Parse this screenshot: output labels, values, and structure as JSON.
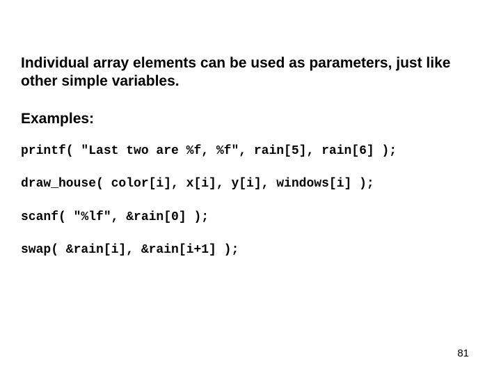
{
  "intro": "Individual array elements can be used as parameters, just like other simple variables.",
  "examples_label": "Examples:",
  "code": {
    "line1": "printf( \"Last two are %f, %f\", rain[5], rain[6] );",
    "line2": "draw_house( color[i], x[i], y[i], windows[i] );",
    "line3": "scanf( \"%lf\", &rain[0] );",
    "line4": "swap( &rain[i], &rain[i+1] );"
  },
  "page_number": "81"
}
